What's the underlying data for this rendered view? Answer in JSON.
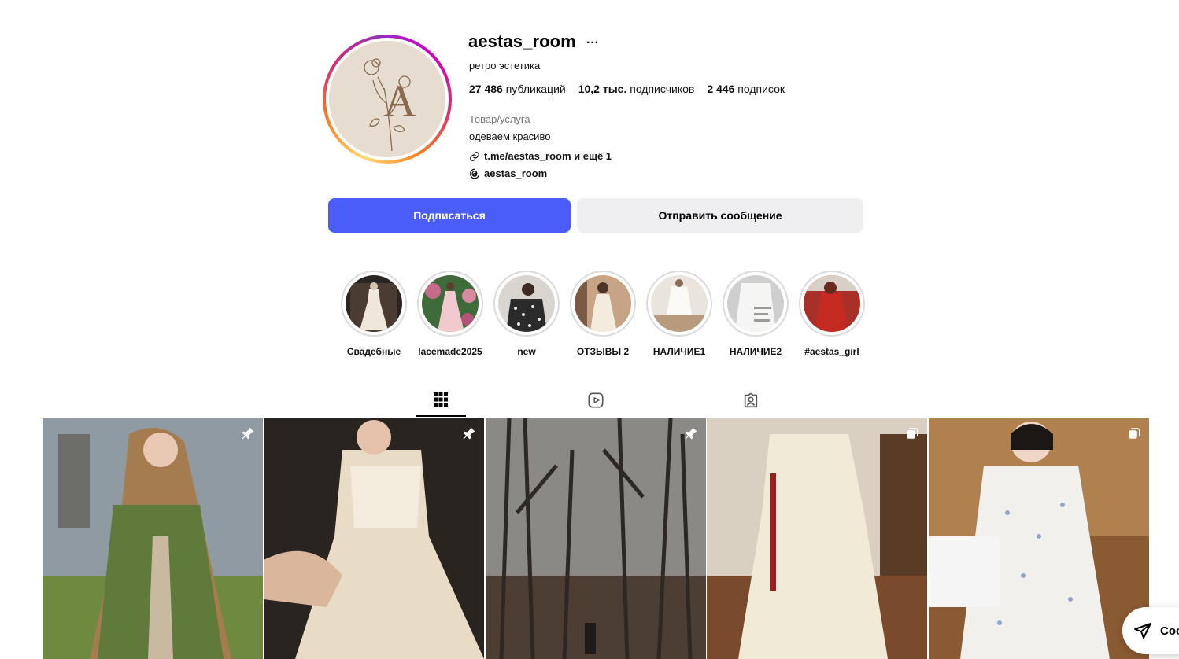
{
  "profile": {
    "username": "aestas_room",
    "more_icon": "···",
    "full_name": "ретро эстетика",
    "stats": {
      "posts_count": "27 486",
      "posts_label": "публикаций",
      "followers_count": "10,2 тыс.",
      "followers_label": "подписчиков",
      "following_count": "2 446",
      "following_label": "подписок"
    },
    "category": "Товар/услуга",
    "bio": "одеваем красиво",
    "link": "t.me/aestas_room и ещё 1",
    "threads": "aestas_room"
  },
  "actions": {
    "follow": "Подписаться",
    "message": "Отправить сообщение"
  },
  "highlights": [
    {
      "label": "Свадебные"
    },
    {
      "label": "lacemade2025"
    },
    {
      "label": "new"
    },
    {
      "label": "ОТЗЫВЫ 2"
    },
    {
      "label": "НАЛИЧИЕ1"
    },
    {
      "label": "НАЛИЧИЕ2"
    },
    {
      "label": "#aestas_girl"
    }
  ],
  "tabs": [
    {
      "icon": "grid-icon",
      "active": true
    },
    {
      "icon": "reels-icon",
      "active": false
    },
    {
      "icon": "tagged-icon",
      "active": false
    }
  ],
  "posts": [
    {
      "badge": "pin-icon"
    },
    {
      "badge": "pin-icon"
    },
    {
      "badge": "pin-icon"
    },
    {
      "badge": "carousel-icon"
    },
    {
      "badge": "carousel-icon"
    }
  ],
  "floating_button": {
    "icon": "send-icon",
    "label": "Соо"
  },
  "colors": {
    "follow_button": "#4a5df9",
    "message_button": "#efeff2",
    "avatar_bg": "#e6ddd0"
  }
}
